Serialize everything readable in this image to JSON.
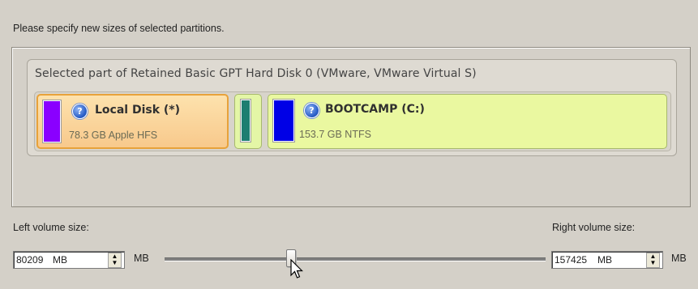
{
  "instruction": "Please specify new sizes of selected partitions.",
  "disk": {
    "title": "Selected part of Retained Basic GPT Hard Disk 0 (VMware, VMware Virtual S)",
    "partitions": [
      {
        "name": "Local Disk (*)",
        "info": "78.3 GB Apple HFS",
        "swatch_color": "#8a00ff",
        "selected": true
      },
      {
        "name": "",
        "info": "",
        "swatch_color": "#1d7e71",
        "selected": false
      },
      {
        "name": "BOOTCAMP (C:)",
        "info": "153.7 GB NTFS",
        "swatch_color": "#0000e6",
        "selected": false
      }
    ]
  },
  "left_volume": {
    "label": "Left volume size:",
    "value": "80209",
    "unit": "MB"
  },
  "right_volume": {
    "label": "Right volume size:",
    "value": "157425",
    "unit": "MB"
  },
  "slider": {
    "left_unit": "MB",
    "right_unit": "MB",
    "position_fraction": 0.33
  },
  "icons": {
    "help": "help-icon",
    "cursor": "mouse-pointer-icon"
  }
}
